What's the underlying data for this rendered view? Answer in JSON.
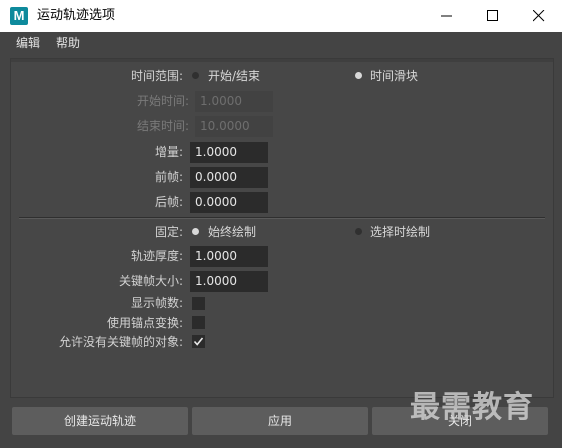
{
  "window": {
    "app_icon_letter": "M",
    "title": "运动轨迹选项"
  },
  "menubar": {
    "items": [
      "编辑",
      "帮助"
    ]
  },
  "options": {
    "time_range": {
      "label": "时间范围:",
      "radio_start_end": "开始/结束",
      "radio_time_slider": "时间滑块",
      "selected": "时间滑块"
    },
    "start_time": {
      "label": "开始时间:",
      "value": "1.0000"
    },
    "end_time": {
      "label": "结束时间:",
      "value": "10.0000"
    },
    "increment": {
      "label": "增量:",
      "value": "1.0000"
    },
    "pre_frame": {
      "label": "前帧:",
      "value": "0.0000"
    },
    "post_frame": {
      "label": "后帧:",
      "value": "0.0000"
    },
    "fixed": {
      "label": "固定:",
      "radio_always": "始终绘制",
      "radio_selected": "选择时绘制",
      "selected": "始终绘制"
    },
    "track_thickness": {
      "label": "轨迹厚度:",
      "value": "1.0000"
    },
    "keyframe_size": {
      "label": "关键帧大小:",
      "value": "1.0000"
    },
    "show_frame_numbers": {
      "label": "显示帧数:",
      "checked": false
    },
    "use_pivot_transform": {
      "label": "使用锚点变换:",
      "checked": false
    },
    "allow_no_keyframes": {
      "label": "允许没有关键帧的对象:",
      "checked": true
    }
  },
  "buttons": {
    "create": "创建运动轨迹",
    "apply": "应用",
    "close": "关闭"
  },
  "watermark": "最需教育"
}
